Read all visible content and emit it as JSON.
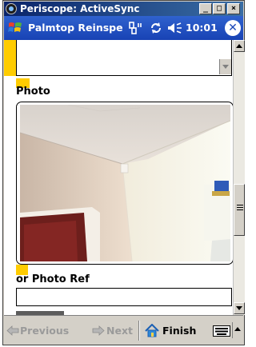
{
  "window": {
    "title": "Periscope: ActiveSync",
    "controls": {
      "minimize": "_",
      "maximize": "□",
      "close": "×"
    }
  },
  "device_header": {
    "app_title": "Palmtop Reinspe",
    "time": "10:01",
    "icons": [
      "windows-start-icon",
      "connectivity-icon",
      "sync-icon",
      "volume-icon",
      "close-icon"
    ]
  },
  "form": {
    "photo_label": "Photo",
    "photo_ref_label": "or Photo Ref",
    "photo_ref_value": "",
    "accent_color": "#ffcc00"
  },
  "toolbar": {
    "previous_label": "Previous",
    "next_label": "Next",
    "finish_label": "Finish"
  },
  "colors": {
    "title_bar": "#0a246a",
    "device_header": "#2352c4",
    "chrome": "#d4d0c8"
  }
}
